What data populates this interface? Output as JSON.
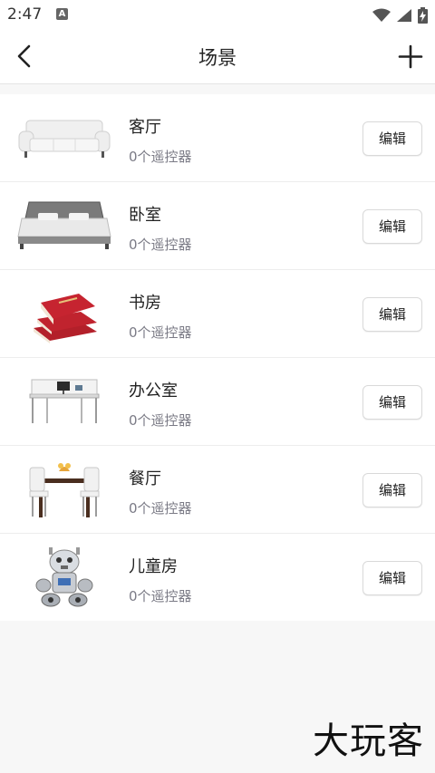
{
  "status_bar": {
    "time": "2:47",
    "notification_badge": "A",
    "icons": [
      "wifi-icon",
      "signal-icon",
      "battery-charging-icon"
    ]
  },
  "header": {
    "title": "场景",
    "back_icon": "back-arrow-icon",
    "add_icon": "plus-icon"
  },
  "scenes": [
    {
      "name": "客厅",
      "count": "0个遥控器",
      "edit_label": "编辑",
      "image": "sofa-image"
    },
    {
      "name": "卧室",
      "count": "0个遥控器",
      "edit_label": "编辑",
      "image": "bed-image"
    },
    {
      "name": "书房",
      "count": "0个遥控器",
      "edit_label": "编辑",
      "image": "books-image"
    },
    {
      "name": "办公室",
      "count": "0个遥控器",
      "edit_label": "编辑",
      "image": "office-desk-image"
    },
    {
      "name": "餐厅",
      "count": "0个遥控器",
      "edit_label": "编辑",
      "image": "dining-table-image"
    },
    {
      "name": "儿童房",
      "count": "0个遥控器",
      "edit_label": "编辑",
      "image": "robot-toy-image"
    }
  ],
  "watermark": "大玩客",
  "colors": {
    "header_bg": "#ffffff",
    "page_bg": "#f7f7f7",
    "secondary_text": "#7b7b86",
    "book_red": "#b3202a"
  }
}
